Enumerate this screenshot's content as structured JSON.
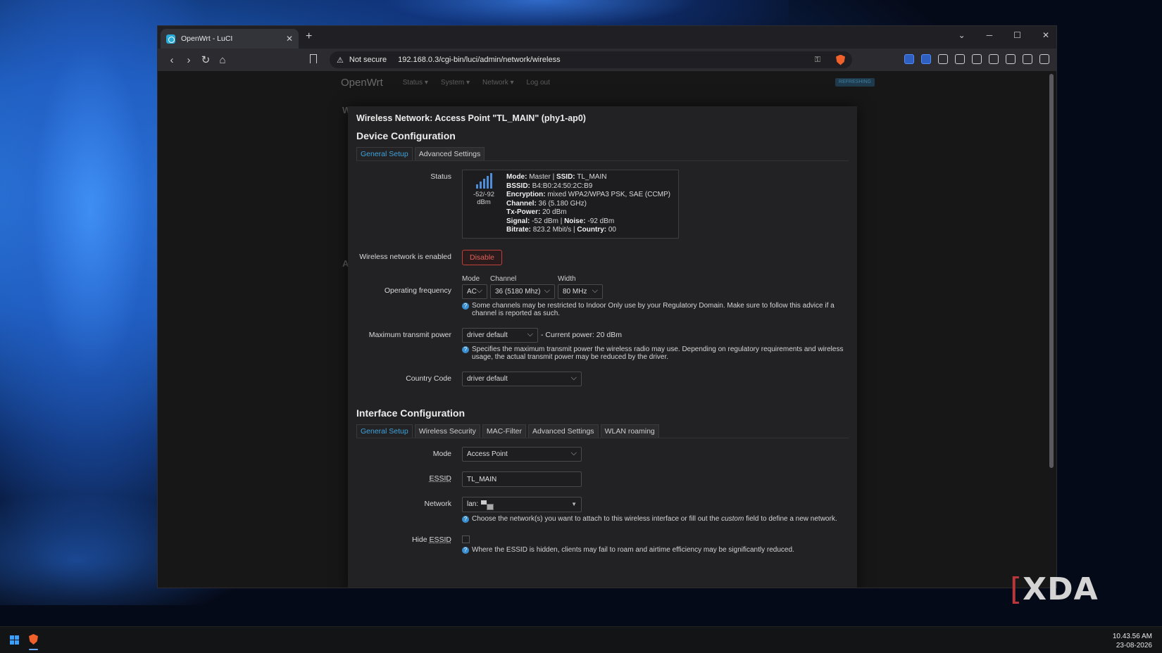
{
  "browser": {
    "tab_title": "OpenWrt - LuCI",
    "new_tab": "+",
    "close_tab": "✕",
    "security_label": "Not secure",
    "url": "192.168.0.3/cgi-bin/luci/admin/network/wireless"
  },
  "luci": {
    "brand": "OpenWrt",
    "nav": [
      "Status ▾",
      "System ▾",
      "Network ▾",
      "Log out"
    ],
    "refresh_badge": "REFRESHING",
    "bg_letter_w": "W",
    "bg_letter_a": "A"
  },
  "modal": {
    "title": "Wireless Network: Access Point \"TL_MAIN\" (phy1-ap0)",
    "device_config": {
      "heading": "Device Configuration",
      "tabs": [
        "General Setup",
        "Advanced Settings"
      ],
      "status_label": "Status",
      "signal_text": "-52/-92 dBm",
      "status_lines": [
        {
          "k1": "Mode:",
          "v1": " Master | ",
          "k2": "SSID:",
          "v2": " TL_MAIN"
        },
        {
          "k1": "BSSID:",
          "v1": " B4:B0:24:50:2C:B9",
          "k2": "",
          "v2": ""
        },
        {
          "k1": "Encryption:",
          "v1": " mixed WPA2/WPA3 PSK, SAE (CCMP)",
          "k2": "",
          "v2": ""
        },
        {
          "k1": "Channel:",
          "v1": " 36 (5.180 GHz)",
          "k2": "",
          "v2": ""
        },
        {
          "k1": "Tx-Power:",
          "v1": " 20 dBm",
          "k2": "",
          "v2": ""
        },
        {
          "k1": "Signal:",
          "v1": " -52 dBm | ",
          "k2": "Noise:",
          "v2": " -92 dBm"
        },
        {
          "k1": "Bitrate:",
          "v1": " 823.2 Mbit/s | ",
          "k2": "Country:",
          "v2": " 00"
        }
      ],
      "enabled_label": "Wireless network is enabled",
      "disable_button": "Disable",
      "op_freq_label": "Operating frequency",
      "mode_sublabel": "Mode",
      "channel_sublabel": "Channel",
      "width_sublabel": "Width",
      "mode_value": "AC",
      "channel_value": "36 (5180 Mhz)",
      "width_value": "80 MHz",
      "channel_hint": "Some channels may be restricted to Indoor Only use by your Regulatory Domain. Make sure to follow this advice if a channel is reported as such.",
      "tx_label": "Maximum transmit power",
      "tx_value": "driver default",
      "current_power": "- Current power: 20 dBm",
      "tx_hint": "Specifies the maximum transmit power the wireless radio may use. Depending on regulatory requirements and wireless usage, the actual transmit power may be reduced by the driver.",
      "country_label": "Country Code",
      "country_value": "driver default"
    },
    "interface_config": {
      "heading": "Interface Configuration",
      "tabs": [
        "General Setup",
        "Wireless Security",
        "MAC-Filter",
        "Advanced Settings",
        "WLAN roaming"
      ],
      "mode_label": "Mode",
      "mode_value": "Access Point",
      "essid_label": "ESSID",
      "essid_value": "TL_MAIN",
      "network_label": "Network",
      "network_value": "lan:",
      "network_hint_pre": "Choose the network(s) you want to attach to this wireless interface or fill out the ",
      "network_hint_em": "custom",
      "network_hint_post": " field to define a new network.",
      "hide_essid_label_pre": "Hide ",
      "hide_essid_label_abbr": "ESSID",
      "hide_hint": "Where the ESSID is hidden, clients may fail to roam and airtime efficiency may be significantly reduced."
    }
  },
  "taskbar": {
    "time": "10.43.56 AM",
    "date": "23-08-2026"
  },
  "watermark": {
    "brand": "XDA"
  }
}
